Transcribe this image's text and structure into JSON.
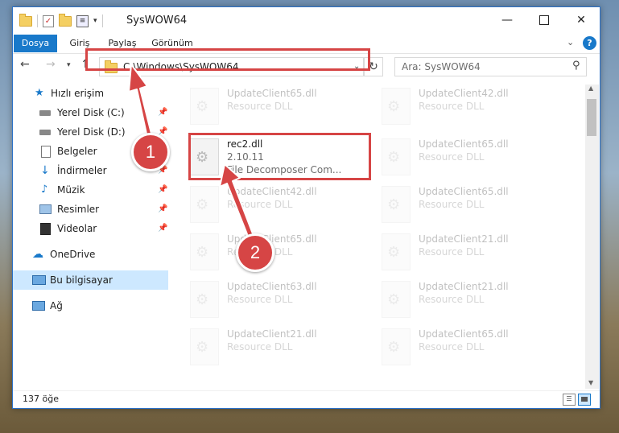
{
  "window": {
    "title": "SysWOW64"
  },
  "ribbon": {
    "tabs": [
      "Dosya",
      "Giriş",
      "Paylaş",
      "Görünüm"
    ],
    "help": "?"
  },
  "address": {
    "path": "C:\\Windows\\SysWOW64"
  },
  "search": {
    "placeholder": "Ara: SysWOW64"
  },
  "sidebar": {
    "items": [
      {
        "label": "Hızlı erişim"
      },
      {
        "label": "Yerel Disk (C:)"
      },
      {
        "label": "Yerel Disk (D:)"
      },
      {
        "label": "Belgeler"
      },
      {
        "label": "İndirmeler"
      },
      {
        "label": "Müzik"
      },
      {
        "label": "Resimler"
      },
      {
        "label": "Videolar"
      },
      {
        "label": "OneDrive"
      },
      {
        "label": "Bu bilgisayar"
      },
      {
        "label": "Ağ"
      }
    ]
  },
  "files": [
    {
      "name": "UpdateClient65.dll",
      "desc": "Resource DLL"
    },
    {
      "name": "UpdateClient42.dll",
      "desc": "Resource DLL"
    },
    {
      "name": "rec2.dll",
      "desc": "2.10.11",
      "desc2": "File Decomposer Com..."
    },
    {
      "name": "UpdateClient65.dll",
      "desc": "Resource DLL"
    },
    {
      "name": "UpdateClient42.dll",
      "desc": "Resource DLL"
    },
    {
      "name": "UpdateClient65.dll",
      "desc": "Resource DLL"
    },
    {
      "name": "UpdateClient65.dll",
      "desc": "Resource DLL"
    },
    {
      "name": "UpdateClient21.dll",
      "desc": "Resource DLL"
    },
    {
      "name": "UpdateClient63.dll",
      "desc": "Resource DLL"
    },
    {
      "name": "UpdateClient21.dll",
      "desc": "Resource DLL"
    },
    {
      "name": "UpdateClient21.dll",
      "desc": "Resource DLL"
    },
    {
      "name": "UpdateClient65.dll",
      "desc": "Resource DLL"
    }
  ],
  "status": {
    "count": "137 öğe"
  },
  "badges": [
    "1",
    "2"
  ],
  "colors": {
    "accent": "#1979ca",
    "highlight": "#d64545",
    "selected": "#cde8ff"
  }
}
